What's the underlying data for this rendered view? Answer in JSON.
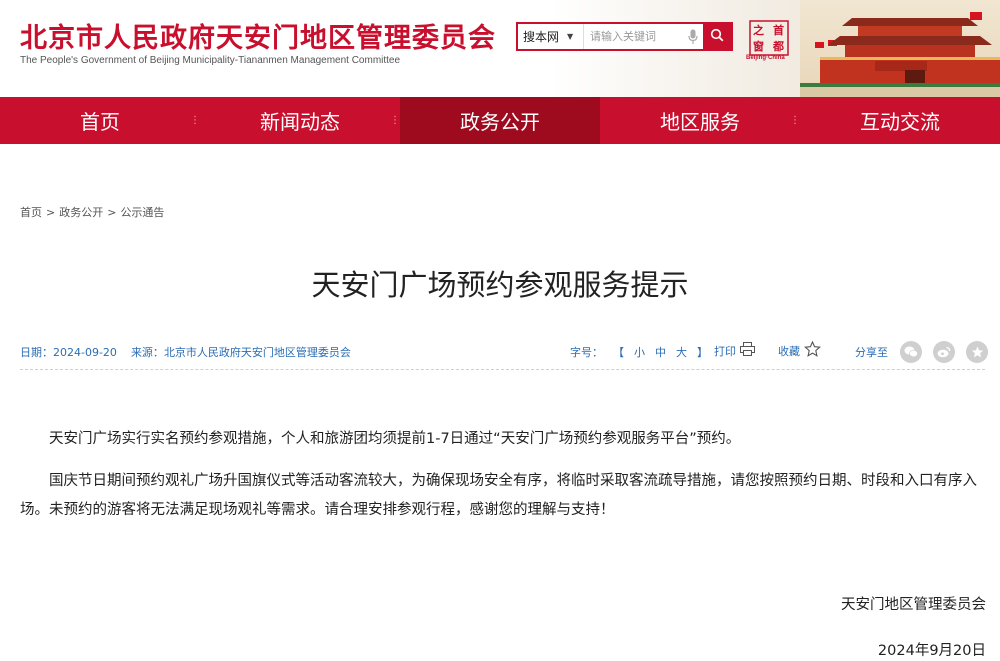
{
  "header": {
    "site_title": "北京市人民政府天安门地区管理委员会",
    "site_subtitle": "The People's Government of Beijing Municipality-Tiananmen Management Committee",
    "logo_caption": "Beijing·China",
    "logo_chars": [
      "首",
      "都",
      "之",
      "窗"
    ],
    "brand_color": "#c8102e"
  },
  "search": {
    "scope_label": "搜本网",
    "placeholder": "请输入关键词",
    "mic_icon": "microphone-icon",
    "button_icon": "search-icon"
  },
  "nav": {
    "items": [
      {
        "label": "首页"
      },
      {
        "label": "新闻动态"
      },
      {
        "label": "政务公开"
      },
      {
        "label": "地区服务"
      },
      {
        "label": "互动交流"
      }
    ],
    "active_index": 2
  },
  "breadcrumb": {
    "items": [
      "首页",
      "政务公开",
      "公示通告"
    ],
    "separator": ">"
  },
  "article": {
    "title": "天安门广场预约参观服务提示",
    "date_label": "日期：",
    "date": "2024-09-20",
    "source_label": "来源：",
    "source": "北京市人民政府天安门地区管理委员会",
    "font_size_label": "字号：",
    "font_size_open": "【",
    "font_size_options": [
      "小",
      "中",
      "大"
    ],
    "font_size_close": "】",
    "print_label": "打印",
    "favorite_label": "收藏",
    "share_label": "分享至",
    "share_icons": [
      "wechat-icon",
      "weibo-icon",
      "star-icon"
    ],
    "paragraphs": [
      "天安门广场实行实名预约参观措施，个人和旅游团均须提前1-7日通过“天安门广场预约参观服务平台”预约。",
      "国庆节日期间预约观礼广场升国旗仪式等活动客流较大，为确保现场安全有序，将临时采取客流疏导措施，请您按照预约日期、时段和入口有序入场。未预约的游客将无法满足现场观礼等需求。请合理安排参观行程，感谢您的理解与支持！"
    ],
    "signature_org": "天安门地区管理委员会",
    "signature_date": "2024年9月20日"
  }
}
